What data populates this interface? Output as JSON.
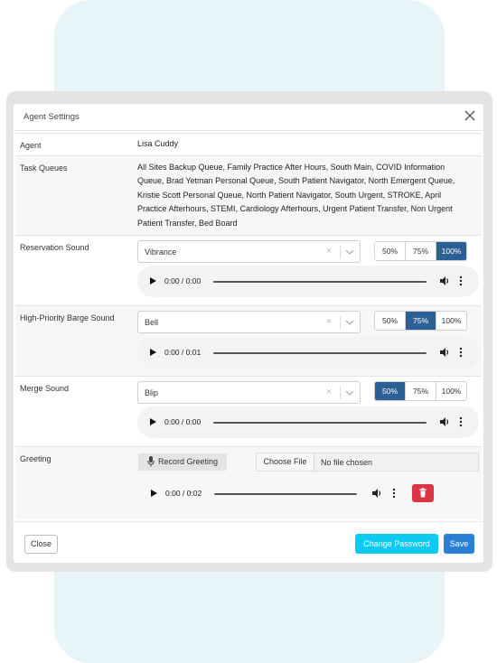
{
  "dialog": {
    "title": "Agent Settings"
  },
  "agent": {
    "label": "Agent",
    "value": "Lisa Cuddy"
  },
  "task_queues": {
    "label": "Task Queues",
    "lines": [
      "All Sites Backup Queue, Family Practice After Hours, South Main, COVID Information",
      "Queue, Brad Yetman Personal Queue, South Patient Navigator, North Emergent Queue,",
      "Kristie Scott Personal Queue, North Patient Navigator, South Urgent, STROKE, April",
      "Practice Afterhours, STEMI, Cardiology Afterhours, Urgent Patient Transfer, Non Urgent",
      "Patient Transfer, Bed Board"
    ]
  },
  "reservation": {
    "label": "Reservation Sound",
    "sound": "Vibrance",
    "clear": "×",
    "volume_options": [
      "50%",
      "75%",
      "100%"
    ],
    "volume_selected": "100%",
    "time": "0:00 / 0:00"
  },
  "barge": {
    "label": "High-Priority Barge Sound",
    "sound": "Bell",
    "clear": "×",
    "volume_options": [
      "50%",
      "75%",
      "100%"
    ],
    "volume_selected": "75%",
    "time": "0:00 / 0:01"
  },
  "merge": {
    "label": "Merge Sound",
    "sound": "Blip",
    "clear": "×",
    "volume_options": [
      "50%",
      "75%",
      "100%"
    ],
    "volume_selected": "50%",
    "time": "0:00 / 0:00"
  },
  "greeting": {
    "label": "Greeting",
    "record_label": "Record Greeting",
    "choose_file_label": "Choose File",
    "file_status": "No file chosen",
    "time": "0:00 / 0:02"
  },
  "footer": {
    "close_label": "Close",
    "change_password_label": "Change Password",
    "save_label": "Save"
  },
  "colors": {
    "active_volume": "#2c5f94",
    "change_password": "#0dcaf0",
    "save": "#2a7fd4",
    "delete": "#dc3545",
    "background_panel": "#e8f5f8"
  },
  "icons": [
    "close-icon",
    "chevron-down-icon",
    "play-icon",
    "volume-icon",
    "more-vertical-icon",
    "microphone-icon",
    "trash-icon"
  ]
}
